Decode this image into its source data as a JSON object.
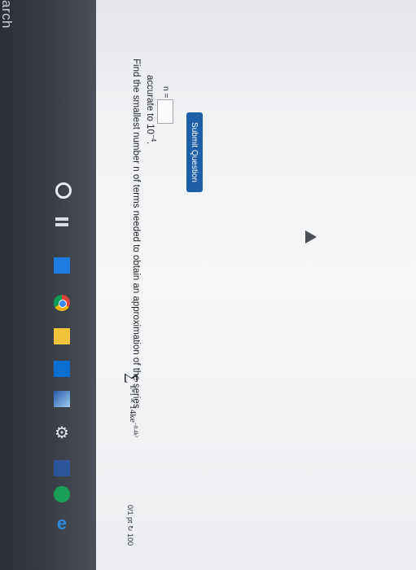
{
  "taskbar": {
    "search_text": "arch",
    "icons": [
      "cortana-icon",
      "task-view-icon",
      "mail-icon",
      "chrome-icon",
      "file-explorer-icon",
      "store-icon",
      "photos-icon",
      "settings-icon",
      "word-icon",
      "phone-icon",
      "edge-icon"
    ]
  },
  "question": {
    "text": "Find the smallest number n of terms needed to obtain an approximation of the series",
    "series_sigma": "∑",
    "series_lower": "k=1",
    "series_upper": "∞",
    "series_term": "14ke",
    "series_exp": "−0.4k²",
    "accurate_text": "accurate to 10",
    "accurate_exp": "−4",
    "accurate_dot": ".",
    "answer_label": "n =",
    "answer_value": "",
    "submit_label": "Submit Question",
    "points_text": "0/1 pt ↻ 100"
  },
  "colors": {
    "button": "#1f5ea8",
    "taskbar": "#2f343b"
  }
}
